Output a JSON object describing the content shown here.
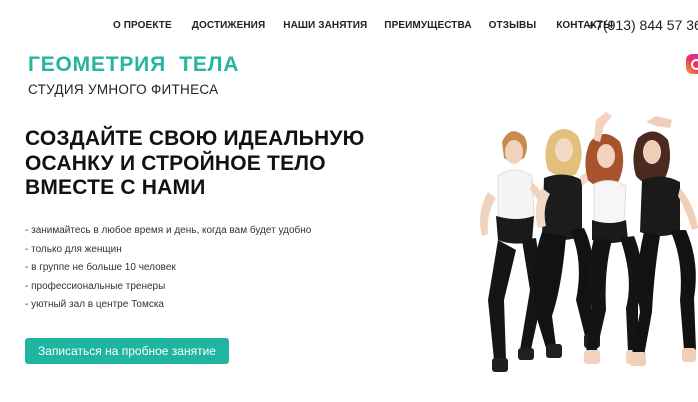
{
  "nav": {
    "items": [
      {
        "label": "О ПРОЕКТЕ"
      },
      {
        "label": "ДОСТИЖЕНИЯ"
      },
      {
        "label": "НАШИ ЗАНЯТИЯ"
      },
      {
        "label": "ПРЕИМУЩЕСТВА"
      },
      {
        "label": "ОТЗЫВЫ"
      },
      {
        "label": "КОНТАКТЫ"
      }
    ]
  },
  "header": {
    "phone": "+7(913) 844 57 36"
  },
  "brand": {
    "title": "ГЕОМЕТРИЯ  ТЕЛА",
    "subtitle": "СТУДИЯ УМНОГО ФИТНЕСА",
    "accent_color": "#25b5a0"
  },
  "hero": {
    "headline_lines": [
      "СОЗДАЙТЕ СВОЮ ИДЕАЛЬНУЮ",
      "ОСАНКУ И СТРОЙНОЕ ТЕЛО",
      "ВМЕСТЕ С НАМИ"
    ],
    "features": [
      "- занимайтесь в любое время и день, когда вам будет удобно",
      "- только для женщин",
      "- в группе не больше 10 человек",
      "- профессиональные тренеры",
      "- уютный зал в центре Томска"
    ],
    "cta_label": "Записаться на пробное занятие",
    "cta_color": "#1fb5a0",
    "photo_icon": "group-of-four-women-photo"
  },
  "social": {
    "icon": "instagram-icon"
  }
}
